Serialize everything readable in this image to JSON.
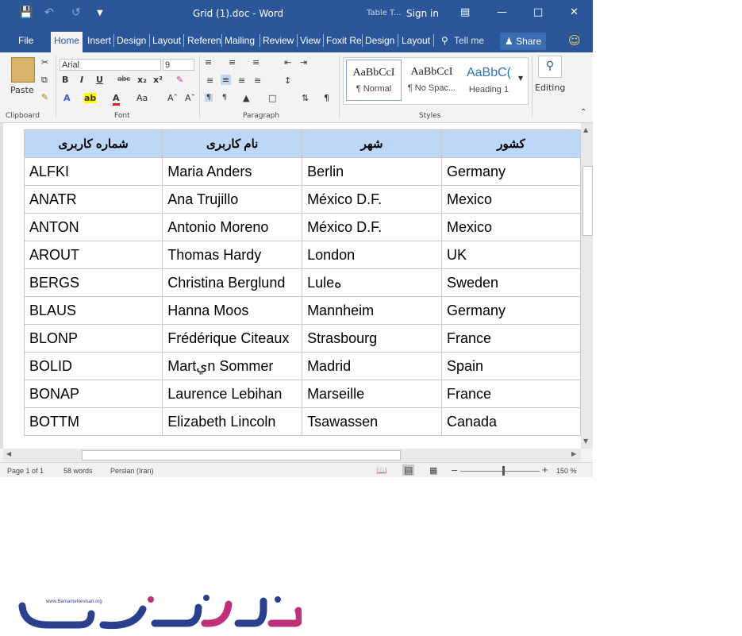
{
  "titlebar": {
    "title": "Grid (1).doc  -  Word",
    "contextual_label": "Table T...",
    "sign_in": "Sign in"
  },
  "tabs": [
    "File",
    "Home",
    "Insert",
    "Design",
    "Layout",
    "Referen",
    "Mailing",
    "Review",
    "View",
    "Foxit Re",
    "Design",
    "Layout"
  ],
  "tell_me": "Tell me",
  "share": "Share",
  "ribbon": {
    "clipboard": {
      "paste": "Paste",
      "label": "Clipboard"
    },
    "font": {
      "name": "Arial",
      "size": "9",
      "label": "Font"
    },
    "paragraph": {
      "label": "Paragraph"
    },
    "styles": {
      "label": "Styles",
      "items": [
        {
          "sample": "AaBbCcI",
          "name": "¶ Normal"
        },
        {
          "sample": "AaBbCcI",
          "name": "¶ No Spac..."
        },
        {
          "sample": "AaBbC(",
          "name": "Heading 1"
        }
      ]
    },
    "editing": {
      "label": "Editing"
    }
  },
  "table": {
    "headers": [
      "شماره کاربری",
      "نام کاربری",
      "شهر",
      "کشور"
    ],
    "rows": [
      [
        "ALFKI",
        "Maria Anders",
        "Berlin",
        "Germany"
      ],
      [
        "ANATR",
        "Ana Trujillo",
        "México D.F.",
        "Mexico"
      ],
      [
        "ANTON",
        "Antonio Moreno",
        "México D.F.",
        "Mexico"
      ],
      [
        "AROUT",
        "Thomas Hardy",
        "London",
        "UK"
      ],
      [
        "BERGS",
        "Christina Berglund",
        "Luleه",
        "Sweden"
      ],
      [
        "BLAUS",
        "Hanna Moos",
        "Mannheim",
        "Germany"
      ],
      [
        "BLONP",
        "Frédérique Citeaux",
        "Strasbourg",
        "France"
      ],
      [
        "BOLID",
        "Martيn Sommer",
        "Madrid",
        "Spain"
      ],
      [
        "BONAP",
        "Laurence Lebihan",
        "Marseille",
        "France"
      ],
      [
        "BOTTM",
        "Elizabeth Lincoln",
        "Tsawassen",
        "Canada"
      ]
    ]
  },
  "status": {
    "page": "Page 1 of 1",
    "words": "58 words",
    "language": "Persian (Iran)",
    "zoom": "150 %"
  },
  "logo": {
    "url_text": "www.BarnameNevisan.org",
    "word": "برنامه نویسان"
  }
}
